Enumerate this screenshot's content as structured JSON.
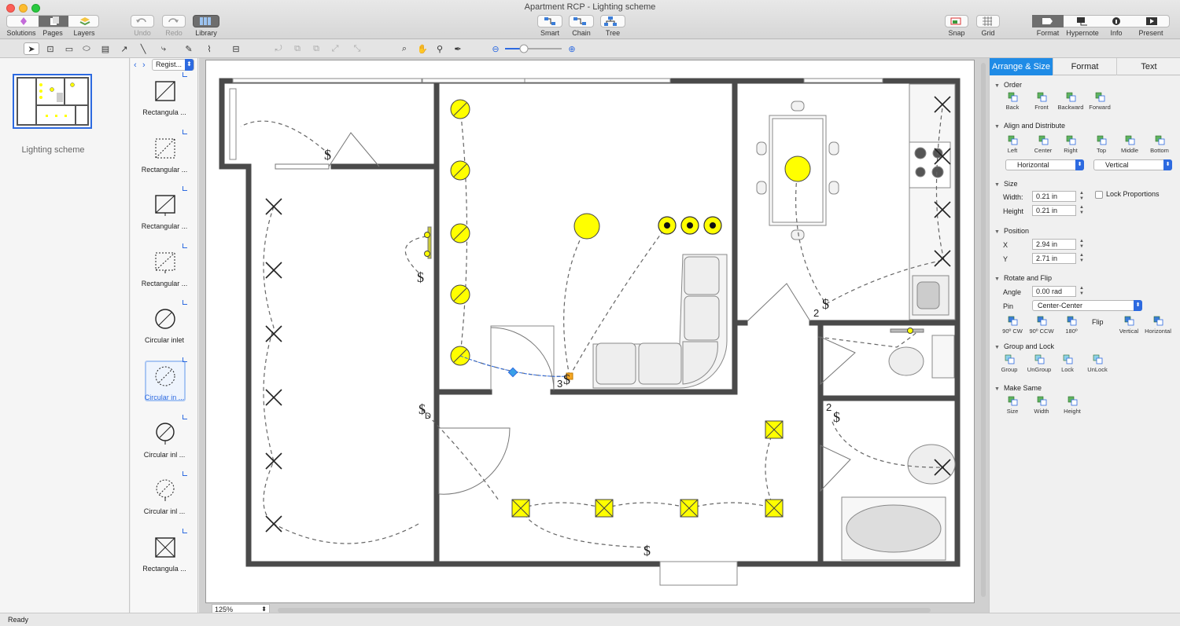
{
  "window": {
    "title": "Apartment RCP - Lighting scheme"
  },
  "toolbar": {
    "solutions": "Solutions",
    "pages": "Pages",
    "layers": "Layers",
    "undo": "Undo",
    "redo": "Redo",
    "library": "Library",
    "smart": "Smart",
    "chain": "Chain",
    "tree": "Tree",
    "snap": "Snap",
    "grid": "Grid",
    "format": "Format",
    "hypernote": "Hypernote",
    "info": "Info",
    "present": "Present"
  },
  "pages_panel": {
    "page_name": "Lighting scheme"
  },
  "library": {
    "selected": "Regist...",
    "items": [
      {
        "label": "Rectangula ...",
        "icon": "rect-inlet-icon"
      },
      {
        "label": "Rectangular ...",
        "icon": "rect-inlet-dashed-icon"
      },
      {
        "label": "Rectangular ...",
        "icon": "rect-inlet-pin-icon"
      },
      {
        "label": "Rectangular ...",
        "icon": "rect-inlet-dashed-pin-icon"
      },
      {
        "label": "Circular inlet",
        "icon": "circular-inlet-icon"
      },
      {
        "label": "Circular in ...",
        "icon": "circular-inlet-dashed-icon"
      },
      {
        "label": "Circular inl ...",
        "icon": "circular-inlet-pin-icon"
      },
      {
        "label": "Circular inl ...",
        "icon": "circular-inlet-dashed-pin-icon"
      },
      {
        "label": "Rectangula ...",
        "icon": "rect-x-inlet-icon"
      }
    ],
    "selected_index": 5
  },
  "canvas": {
    "zoom": "125%",
    "labels": {
      "switch_3": "3",
      "switch_2a": "2",
      "switch_2b": "2",
      "door_d": "D"
    },
    "switch_symbol": "$"
  },
  "right_panel": {
    "tabs": [
      "Arrange & Size",
      "Format",
      "Text"
    ],
    "active_tab": "Arrange & Size",
    "order": {
      "title": "Order",
      "buttons": [
        "Back",
        "Front",
        "Backward",
        "Forward"
      ]
    },
    "align": {
      "title": "Align and Distribute",
      "buttons": [
        "Left",
        "Center",
        "Right",
        "Top",
        "Middle",
        "Bottom"
      ],
      "horizontal": "Horizontal",
      "vertical": "Vertical"
    },
    "size": {
      "title": "Size",
      "width_label": "Width:",
      "width": "0.21 in",
      "height_label": "Height",
      "height": "0.21 in",
      "lock": "Lock Proportions"
    },
    "position": {
      "title": "Position",
      "x_label": "X",
      "x": "2.94 in",
      "y_label": "Y",
      "y": "2.71 in"
    },
    "rotate": {
      "title": "Rotate and Flip",
      "angle_label": "Angle",
      "angle": "0.00 rad",
      "pin_label": "Pin",
      "pin": "Center-Center",
      "buttons": [
        "90º CW",
        "90º CCW",
        "180º"
      ],
      "flip": "Flip",
      "flip_buttons": [
        "Vertical",
        "Horizontal"
      ]
    },
    "group": {
      "title": "Group and Lock",
      "buttons": [
        "Group",
        "UnGroup",
        "Lock",
        "UnLock"
      ]
    },
    "make_same": {
      "title": "Make Same",
      "buttons": [
        "Size",
        "Width",
        "Height"
      ]
    }
  },
  "status": {
    "text": "Ready"
  },
  "colors": {
    "accent": "#1f8be6",
    "lamp": "#ffff00",
    "wall": "#4a4a4a"
  }
}
